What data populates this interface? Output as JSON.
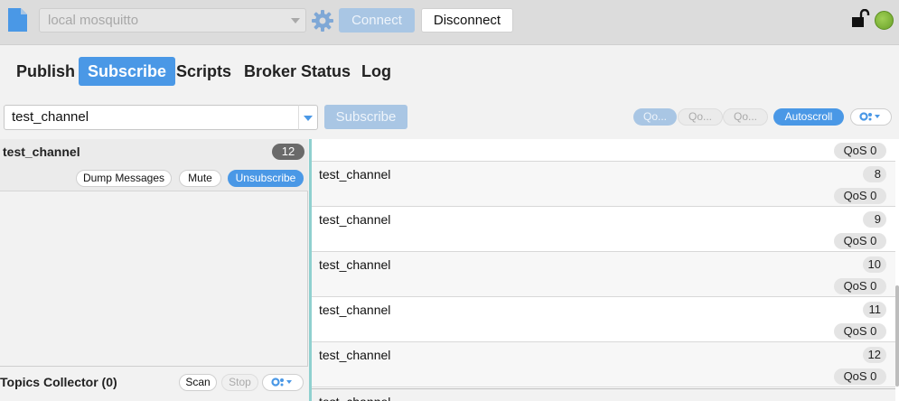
{
  "toolbar": {
    "connection": {
      "value": "local mosquitto"
    },
    "connect_label": "Connect",
    "disconnect_label": "Disconnect",
    "icons": [
      "file-icon",
      "gear-icon",
      "lock-icon",
      "status-dot"
    ],
    "colors": {
      "accent": "#4a98e6",
      "status": "#7ab632"
    }
  },
  "nav": {
    "tabs": [
      {
        "label": "Publish",
        "active": false
      },
      {
        "label": "Subscribe",
        "active": true
      },
      {
        "label": "Scripts",
        "active": false
      },
      {
        "label": "Broker Status",
        "active": false
      },
      {
        "label": "Log",
        "active": false
      }
    ]
  },
  "subscribe": {
    "topic_value": "test_channel",
    "button_label": "Subscribe",
    "qos_options": [
      "Qo...",
      "Qo...",
      "Qo..."
    ],
    "autoscroll_label": "Autoscroll",
    "settings_icon": "gear-dropdown-icon"
  },
  "subscriptions": [
    {
      "topic": "test_channel",
      "count": "12",
      "buttons": {
        "dump": "Dump Messages",
        "mute": "Mute",
        "unsubscribe": "Unsubscribe"
      }
    }
  ],
  "collector": {
    "label": "Topics Collector (0)",
    "scan_label": "Scan",
    "stop_label": "Stop"
  },
  "messages": {
    "top_qos": "QoS 0",
    "items": [
      {
        "topic": "test_channel",
        "number": "8",
        "qos": "QoS 0"
      },
      {
        "topic": "test_channel",
        "number": "9",
        "qos": "QoS 0"
      },
      {
        "topic": "test_channel",
        "number": "10",
        "qos": "QoS 0"
      },
      {
        "topic": "test_channel",
        "number": "11",
        "qos": "QoS 0"
      },
      {
        "topic": "test_channel",
        "number": "12",
        "qos": "QoS 0"
      }
    ],
    "partial_topic": "test_channel"
  }
}
